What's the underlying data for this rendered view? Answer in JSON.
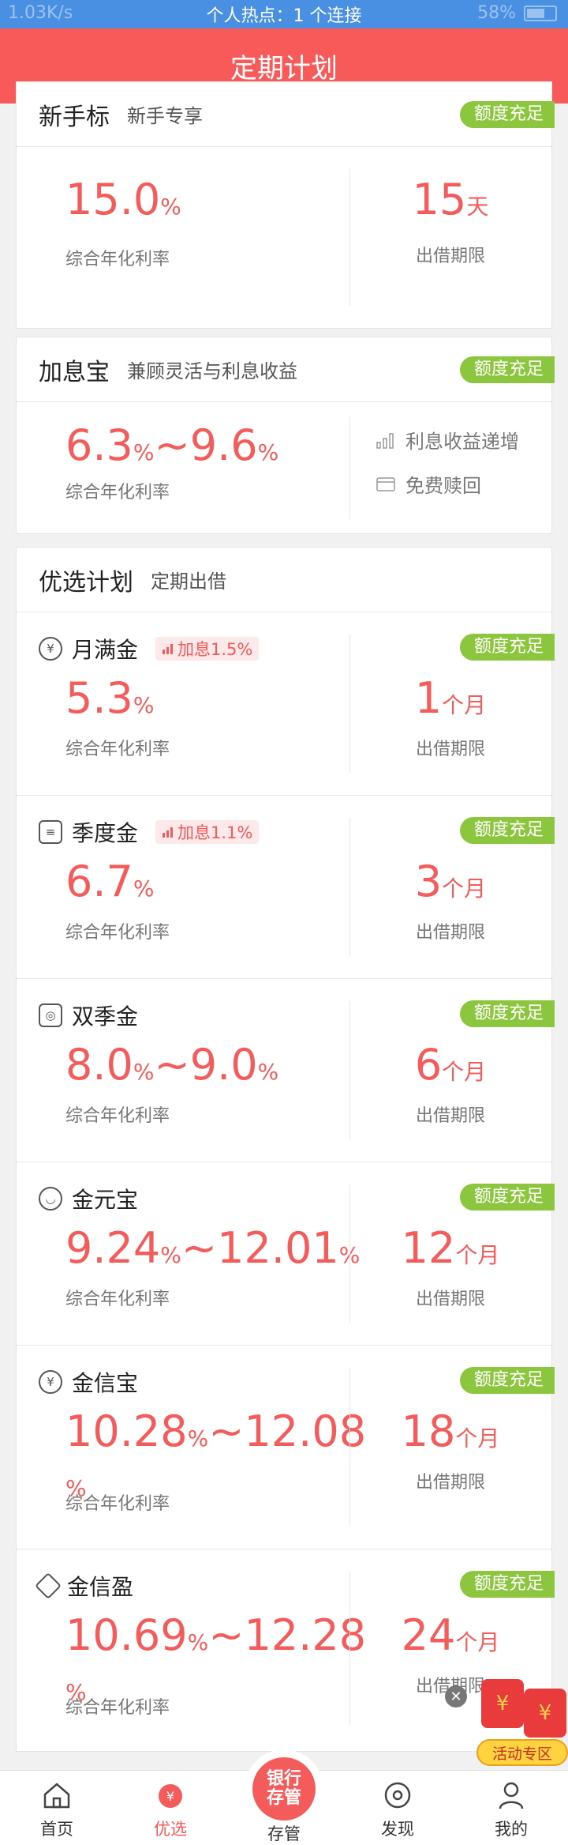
{
  "status_bar": {
    "left": "1.03K/s",
    "center": "个人热点：1 个连接",
    "battery": "58%"
  },
  "header": {
    "title": "定期计划"
  },
  "badge_text": "额度充足",
  "newbie": {
    "title": "新手标",
    "subtitle": "新手专享",
    "rate": "15.0",
    "rate_unit": "%",
    "rate_label": "综合年化利率",
    "term": "15",
    "term_unit": "天",
    "term_label": "出借期限"
  },
  "interest": {
    "title": "加息宝",
    "subtitle": "兼顾灵活与利息收益",
    "rate_min": "6.3",
    "rate_max": "9.6",
    "rate_unit": "%",
    "sep": "~",
    "rate_label": "综合年化利率",
    "features": [
      "利息收益递增",
      "免费赎回"
    ]
  },
  "preferred": {
    "title": "优选计划",
    "subtitle": "定期出借"
  },
  "plans": [
    {
      "name": "月满金",
      "icon": "yen-coin-icon",
      "tag": "加息1.5%",
      "rate": "5.3",
      "rate_unit": "%",
      "rate_label": "综合年化利率",
      "term": "1",
      "term_unit": "个月",
      "term_label": "出借期限"
    },
    {
      "name": "季度金",
      "icon": "coin-stack-icon",
      "tag": "加息1.1%",
      "rate": "6.7",
      "rate_unit": "%",
      "rate_label": "综合年化利率",
      "term": "3",
      "term_unit": "个月",
      "term_label": "出借期限"
    },
    {
      "name": "双季金",
      "icon": "coins-icon",
      "rate_min": "8.0",
      "rate_max": "9.0",
      "rate_unit": "%",
      "sep": "~",
      "rate_label": "综合年化利率",
      "term": "6",
      "term_unit": "个月",
      "term_label": "出借期限"
    },
    {
      "name": "金元宝",
      "icon": "ingot-icon",
      "rate_min": "9.24",
      "rate_max": "12.01",
      "rate_unit": "%",
      "sep": "~",
      "rate_label": "综合年化利率",
      "term": "12",
      "term_unit": "个月",
      "term_label": "出借期限"
    },
    {
      "name": "金信宝",
      "icon": "money-bag-icon",
      "rate_min": "10.28",
      "rate_max": "12.08",
      "rate_unit": "%",
      "sep": "~",
      "rate_label": "综合年化利率",
      "term": "18",
      "term_unit": "个月",
      "term_label": "出借期限"
    },
    {
      "name": "金信盈",
      "icon": "diamond-icon",
      "rate_min": "10.69",
      "rate_max": "12.28",
      "rate_unit": "%",
      "sep": "~",
      "rate_label": "综合年化利率",
      "term": "24",
      "term_unit": "个月",
      "term_label": "出借期限"
    }
  ],
  "promo": {
    "label": "活动专区",
    "coin": "¥"
  },
  "tabs": {
    "home": "首页",
    "preferred": "优选",
    "center_line1": "银行",
    "center_line2": "存管",
    "center": "存管",
    "discover": "发现",
    "mine": "我的"
  },
  "colors": {
    "header": "#f85a5a",
    "accent": "#f45b5b",
    "badge": "#8cc63e",
    "status_bar": "#4a90e2"
  }
}
